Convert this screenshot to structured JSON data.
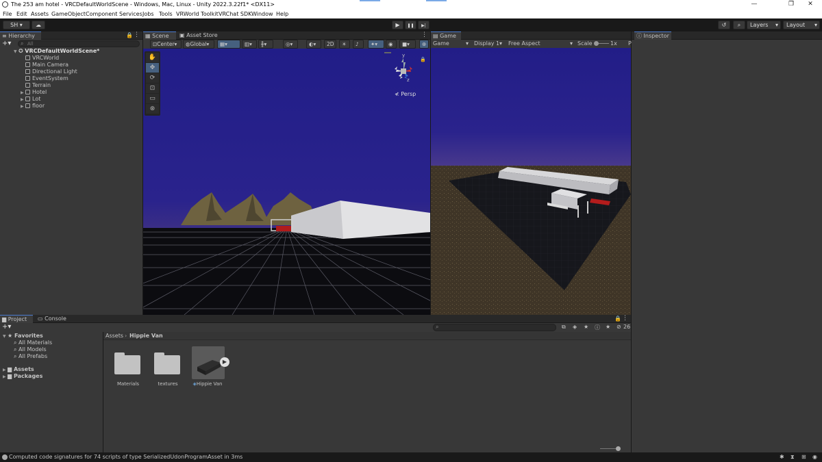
{
  "window": {
    "title": "The 253 am hotel - VRCDefaultWorldScene - Windows, Mac, Linux - Unity 2022.3.22f1* <DX11>",
    "minimize": "—",
    "maximize": "❐",
    "close": "✕"
  },
  "menu": [
    "File",
    "Edit",
    "Assets",
    "GameObject",
    "Component",
    "Services",
    "Jobs",
    "Tools",
    "VRWorld Toolkit",
    "VRChat SDK",
    "Window",
    "Help"
  ],
  "toolbar": {
    "account": "SH ▾",
    "cloud_icon": "cloud-icon",
    "play_icon": "▶",
    "pause_icon": "❚❚",
    "step_icon": "▶|",
    "history_icon": "↺",
    "search_icon": "⌕",
    "layers": "Layers",
    "layout": "Layout"
  },
  "hierarchy": {
    "tab": "Hierarchy",
    "search_placeholder": "All",
    "scene": "VRCDefaultWorldScene*",
    "items": [
      {
        "label": "VRCWorld",
        "expandable": false
      },
      {
        "label": "Main Camera",
        "expandable": false
      },
      {
        "label": "Directional Light",
        "expandable": false
      },
      {
        "label": "EventSystem",
        "expandable": false
      },
      {
        "label": "Terrain",
        "expandable": false
      },
      {
        "label": "Hotel",
        "expandable": true
      },
      {
        "label": "Lot",
        "expandable": true
      },
      {
        "label": "floor",
        "expandable": true
      }
    ]
  },
  "scene": {
    "tab_scene": "Scene",
    "tab_asset_store": "Asset Store",
    "pivot": "Center",
    "space": "Global",
    "mode_2d": "2D",
    "persp": "≮ Persp",
    "gizmo_y": "y",
    "gizmo_z": "z"
  },
  "game": {
    "tab": "Game",
    "mode": "Game",
    "display": "Display 1",
    "aspect": "Free Aspect",
    "scale_label": "Scale",
    "scale_value": "1x",
    "play_focus": "P"
  },
  "inspector": {
    "tab": "Inspector"
  },
  "project": {
    "tab_project": "Project",
    "tab_console": "Console",
    "favorites": "Favorites",
    "fav_items": [
      "All Materials",
      "All Models",
      "All Prefabs"
    ],
    "roots": [
      "Assets",
      "Packages"
    ],
    "breadcrumb_root": "Assets",
    "breadcrumb_current": "Hippie Van",
    "count": "26",
    "assets": [
      {
        "label": "Materials",
        "kind": "folder"
      },
      {
        "label": "textures",
        "kind": "folder"
      },
      {
        "label": "Hippie Van",
        "kind": "model"
      }
    ]
  },
  "status": {
    "message": "Computed code signatures for 74 scripts of type SerializedUdonProgramAsset in 3ms"
  },
  "colors": {
    "accent": "#4a7bd0",
    "panel": "#383838",
    "header": "#282828",
    "sky": "#201e86",
    "grid": "#0d0d12"
  }
}
